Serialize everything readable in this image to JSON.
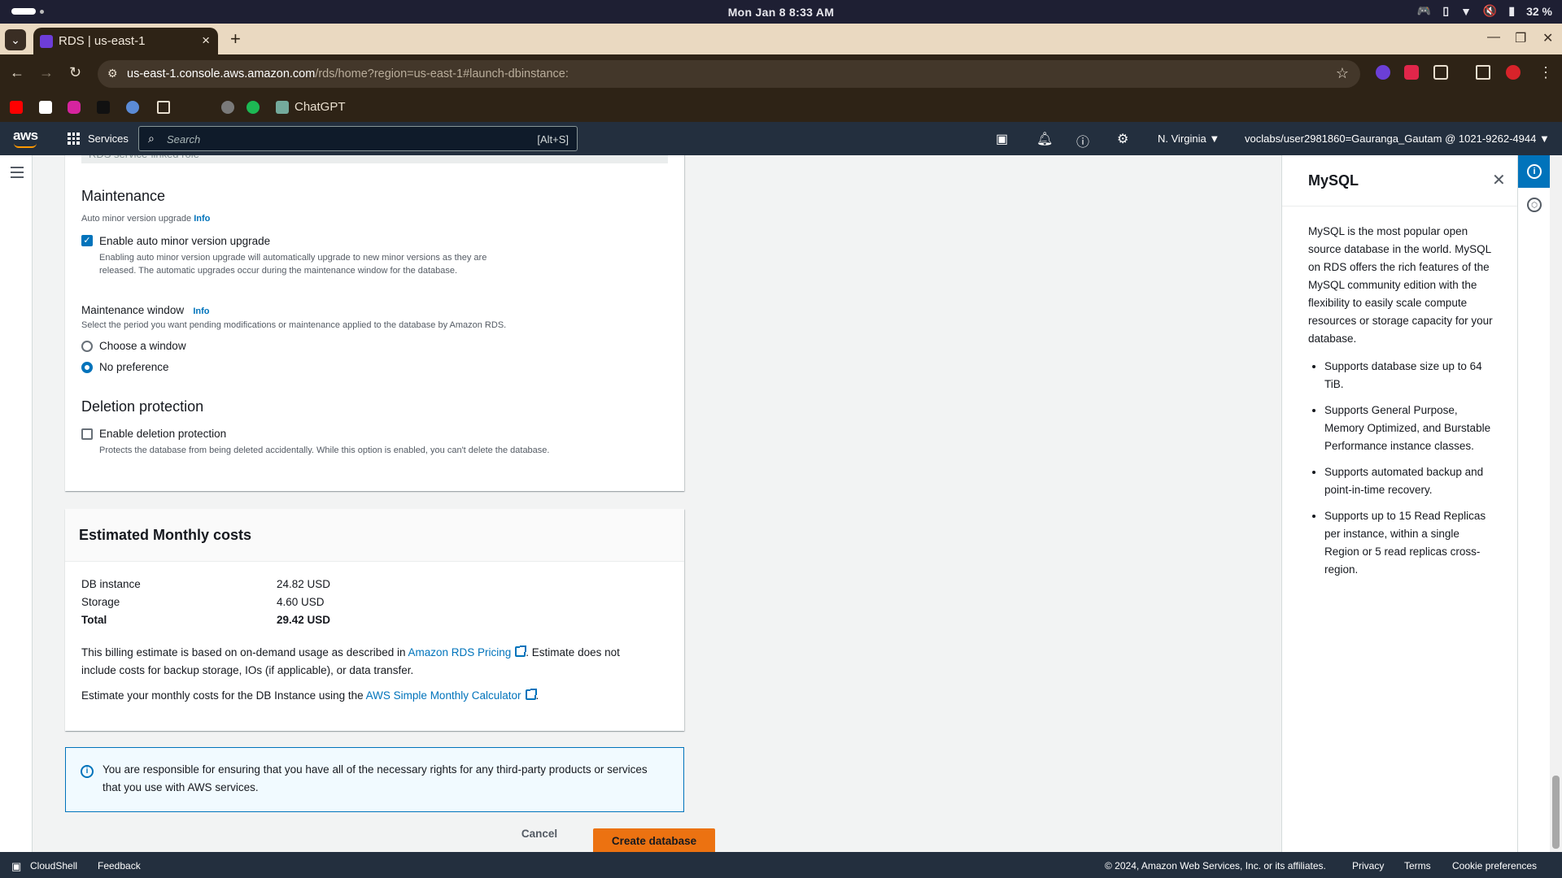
{
  "os": {
    "clock": "Mon Jan 8   8:33 AM",
    "battery": "32 %"
  },
  "browser": {
    "tab_title": "RDS | us-east-1",
    "url_host": "us-east-1.console.aws.amazon.com",
    "url_path": "/rds/home?region=us-east-1#launch-dbinstance:",
    "bookmark_chatgpt": "ChatGPT"
  },
  "aws": {
    "logo": "aws",
    "services": "Services",
    "search_placeholder": "Search",
    "search_shortcut": "[Alt+S]",
    "region": "N. Virginia",
    "account": "voclabs/user2981860=Gauranga_Gautam @ 1021-9262-4944"
  },
  "form": {
    "role_placeholder": "RDS service-linked role",
    "maintenance": {
      "heading": "Maintenance",
      "auto_minor_label": "Auto minor version upgrade",
      "info": "Info",
      "enable_auto_minor": "Enable auto minor version upgrade",
      "enable_auto_minor_desc": "Enabling auto minor version upgrade will automatically upgrade to new minor versions as they are released. The automatic upgrades occur during the maintenance window for the database.",
      "window_label": "Maintenance window",
      "window_desc": "Select the period you want pending modifications or maintenance applied to the database by Amazon RDS.",
      "choose_window": "Choose a window",
      "no_preference": "No preference"
    },
    "deletion": {
      "heading": "Deletion protection",
      "enable": "Enable deletion protection",
      "desc": "Protects the database from being deleted accidentally. While this option is enabled, you can't delete the database."
    }
  },
  "costs": {
    "heading": "Estimated Monthly costs",
    "rows": [
      {
        "label": "DB instance",
        "value": "24.82 USD"
      },
      {
        "label": "Storage",
        "value": "4.60 USD"
      },
      {
        "label": "Total",
        "value": "29.42 USD"
      }
    ],
    "billing_pre": "This billing estimate is based on on-demand usage as described in ",
    "billing_link": "Amazon RDS Pricing",
    "billing_post1": ". Estimate does not",
    "billing_post2": "include costs for backup storage, IOs (if applicable), or data transfer.",
    "calc_pre": "Estimate your monthly costs for the DB Instance using the ",
    "calc_link": "AWS Simple Monthly Calculator",
    "calc_post": "."
  },
  "alert": "You are responsible for ensuring that you have all of the necessary rights for any third-party products or services that you use with AWS services.",
  "actions": {
    "cancel": "Cancel",
    "create": "Create database"
  },
  "help": {
    "title": "MySQL",
    "intro": "MySQL is the most popular open source database in the world. MySQL on RDS offers the rich features of the MySQL community edition with the flexibility to easily scale compute resources or storage capacity for your database.",
    "bullets": [
      "Supports database size up to 64 TiB.",
      "Supports General Purpose, Memory Optimized, and Burstable Performance instance classes.",
      "Supports automated backup and point-in-time recovery.",
      "Supports up to 15 Read Replicas per instance, within a single Region or 5 read replicas cross-region."
    ]
  },
  "footer": {
    "cloudshell": "CloudShell",
    "feedback": "Feedback",
    "copyright": "© 2024, Amazon Web Services, Inc. or its affiliates.",
    "privacy": "Privacy",
    "terms": "Terms",
    "cookies": "Cookie preferences"
  },
  "colors": {
    "aws_nav": "#232f3e",
    "primary_button": "#ec7211",
    "link": "#0073bb",
    "tab_strip": "#ead9c1"
  }
}
